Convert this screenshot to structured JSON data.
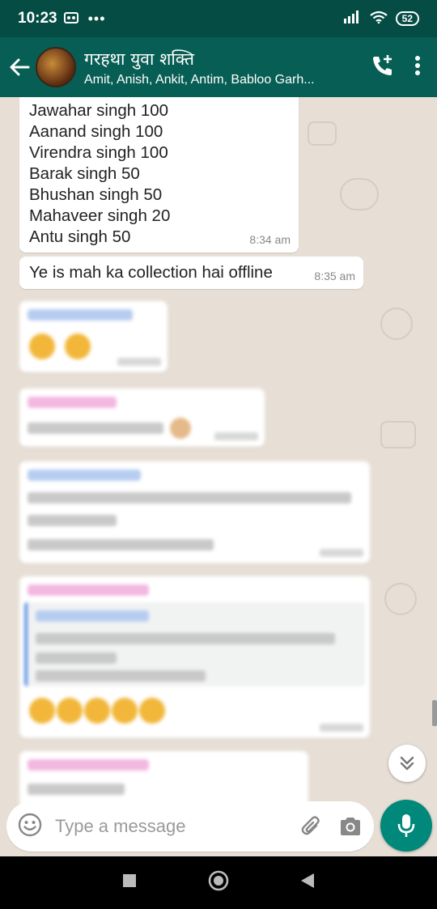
{
  "status_bar": {
    "time": "10:23",
    "dots": "•••",
    "battery": "52"
  },
  "header": {
    "title": "गरहथा युवा शक्ति",
    "subtitle": "Amit, Anish, Ankit, Antim, Babloo Garh...",
    "icons": [
      "back-arrow-icon",
      "add-call-icon",
      "more-vert-icon"
    ]
  },
  "messages": [
    {
      "lines": [
        "Jawahar singh 100",
        "Aanand singh 100",
        "Virendra singh 100",
        "Barak singh 50",
        "Bhushan singh 50",
        "Mahaveer singh 20",
        "Antu singh 50"
      ],
      "time": "8:34 am"
    },
    {
      "text": "Ye is mah ka collection hai offline",
      "time": "8:35 am"
    }
  ],
  "composer": {
    "placeholder": "Type a message"
  },
  "colors": {
    "header": "#075e54",
    "status_bar": "#054d44",
    "accent": "#00897b",
    "chat_bg": "#e7dfd6"
  }
}
